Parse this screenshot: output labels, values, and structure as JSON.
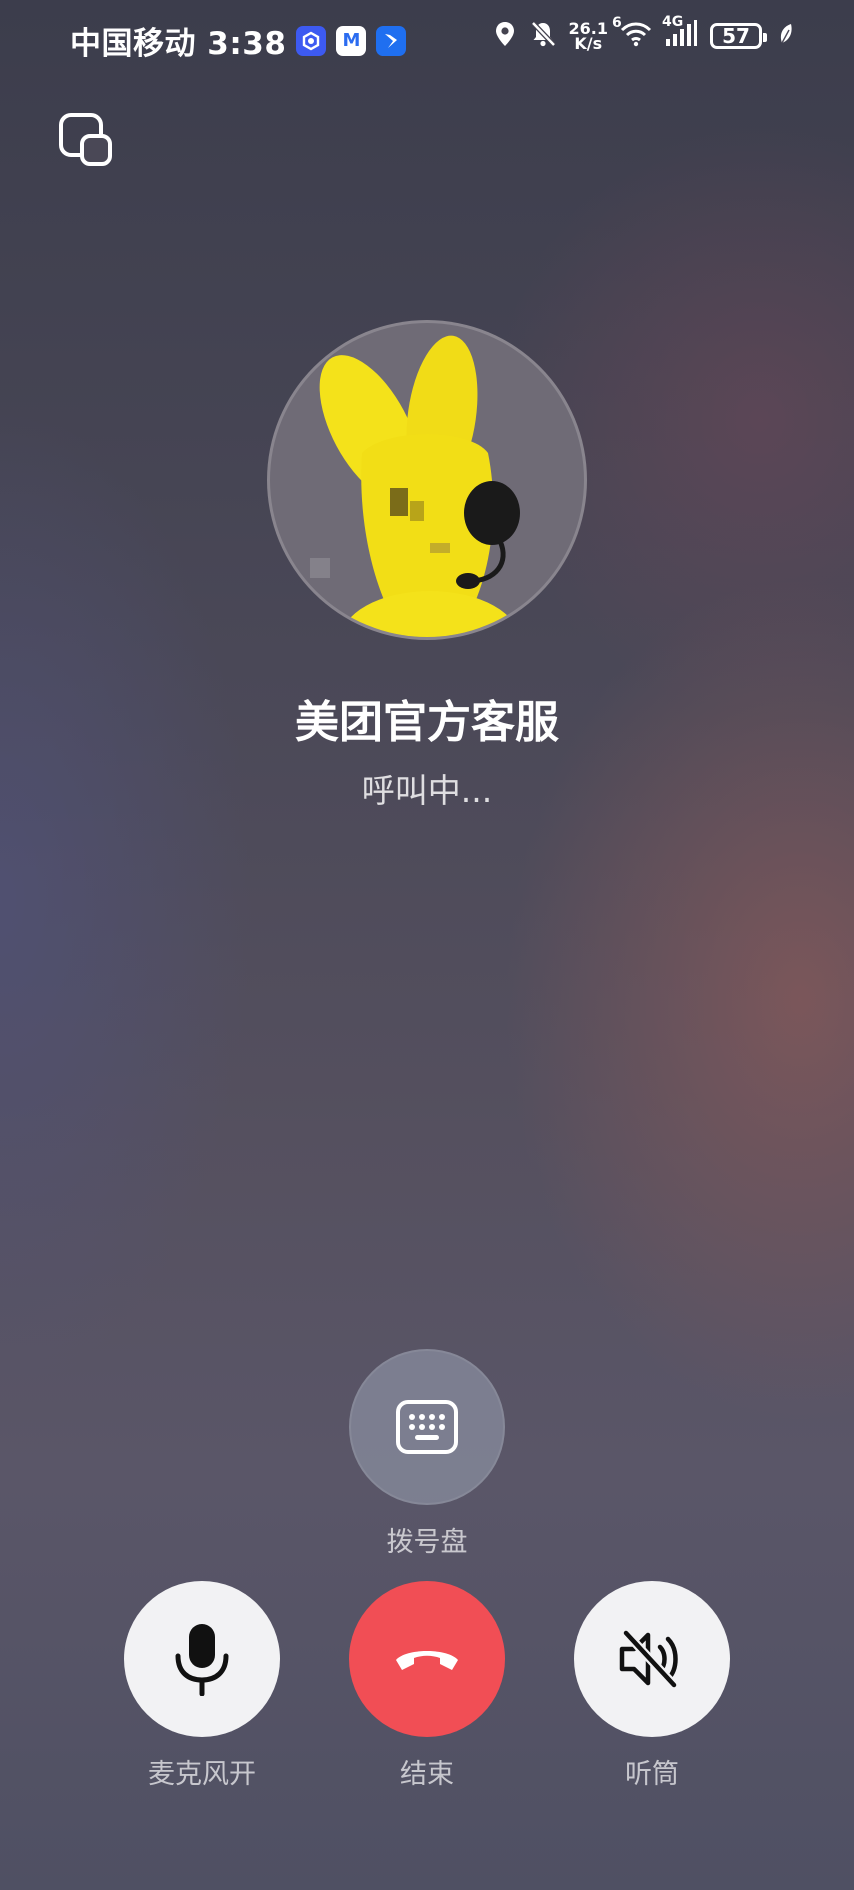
{
  "status_bar": {
    "carrier_time": "中国移动 3:38",
    "network_speed_value": "26.1",
    "network_speed_unit": "K/s",
    "wifi_tag": "6",
    "cellular_tag": "4G",
    "battery_level": "57"
  },
  "contact": {
    "name": "美团官方客服",
    "status": "呼叫中..."
  },
  "controls": {
    "keypad_label": "拨号盘",
    "mic_label": "麦克风开",
    "end_label": "结束",
    "speaker_label": "听筒"
  },
  "colors": {
    "end_call": "#f14e55",
    "control_light": "#f2f2f4",
    "keypad_bg": "#82869a"
  }
}
